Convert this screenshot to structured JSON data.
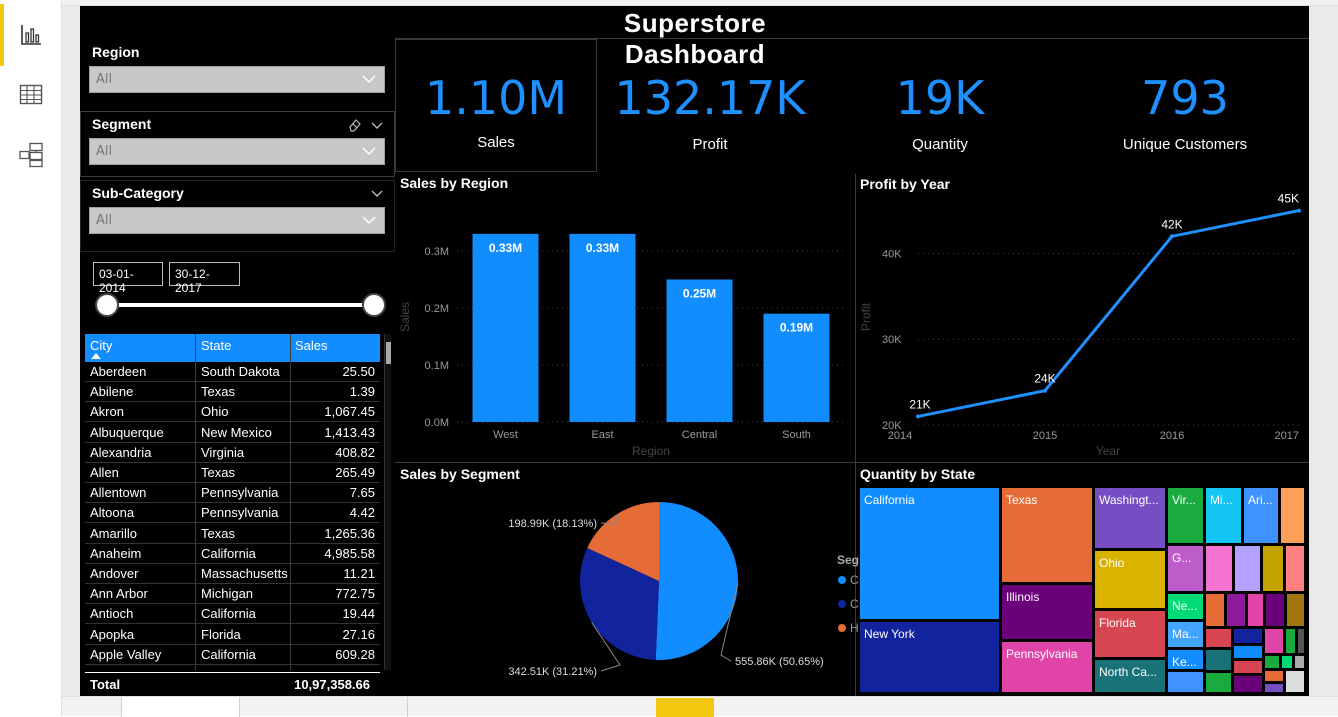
{
  "dashboard": {
    "title": "Superstore Dashboard"
  },
  "nav": {
    "items": [
      "report-view",
      "data-view",
      "model-view"
    ]
  },
  "slicers": {
    "region": {
      "label": "Region",
      "value": "All"
    },
    "segment": {
      "label": "Segment",
      "value": "All"
    },
    "subcategory": {
      "label": "Sub-Category",
      "value": "All"
    },
    "date": {
      "start": "03-01-2014",
      "end": "30-12-2017"
    }
  },
  "table": {
    "headers": [
      "City",
      "State",
      "Sales"
    ],
    "rows": [
      [
        "Aberdeen",
        "South Dakota",
        "25.50"
      ],
      [
        "Abilene",
        "Texas",
        "1.39"
      ],
      [
        "Akron",
        "Ohio",
        "1,067.45"
      ],
      [
        "Albuquerque",
        "New Mexico",
        "1,413.43"
      ],
      [
        "Alexandria",
        "Virginia",
        "408.82"
      ],
      [
        "Allen",
        "Texas",
        "265.49"
      ],
      [
        "Allentown",
        "Pennsylvania",
        "7.65"
      ],
      [
        "Altoona",
        "Pennsylvania",
        "4.42"
      ],
      [
        "Amarillo",
        "Texas",
        "1,265.36"
      ],
      [
        "Anaheim",
        "California",
        "4,985.58"
      ],
      [
        "Andover",
        "Massachusetts",
        "11.21"
      ],
      [
        "Ann Arbor",
        "Michigan",
        "772.75"
      ],
      [
        "Antioch",
        "California",
        "19.44"
      ],
      [
        "Apopka",
        "Florida",
        "27.16"
      ],
      [
        "Apple Valley",
        "California",
        "609.28"
      ]
    ],
    "total_label": "Total",
    "total_value": "10,97,358.66"
  },
  "kpis": [
    {
      "value": "1.10M",
      "label": "Sales"
    },
    {
      "value": "132.17K",
      "label": "Profit"
    },
    {
      "value": "19K",
      "label": "Quantity"
    },
    {
      "value": "793",
      "label": "Unique Customers"
    }
  ],
  "colors": {
    "accent": "#118dff",
    "line": "#1e90ff",
    "consumer": "#118dff",
    "corporate": "#12239e",
    "home_office": "#e66c37"
  },
  "chart_data": [
    {
      "type": "bar",
      "title": "Sales by Region",
      "xlabel": "Region",
      "ylabel": "Sales",
      "categories": [
        "West",
        "East",
        "Central",
        "South"
      ],
      "values": [
        0.33,
        0.33,
        0.25,
        0.19
      ],
      "data_labels": [
        "0.33M",
        "0.33M",
        "0.25M",
        "0.19M"
      ],
      "yticks": [
        "0.0M",
        "0.1M",
        "0.2M",
        "0.3M"
      ],
      "ylim": [
        0,
        0.33
      ],
      "grid": true
    },
    {
      "type": "line",
      "title": "Profit by Year",
      "xlabel": "Year",
      "ylabel": "Profit",
      "x": [
        "2014",
        "2015",
        "2016",
        "2017"
      ],
      "values": [
        21,
        24,
        42,
        45
      ],
      "data_labels": [
        "21K",
        "24K",
        "42K",
        "45K"
      ],
      "yticks": [
        "20K",
        "30K",
        "40K"
      ],
      "ylim": [
        20,
        46
      ],
      "grid": true
    },
    {
      "type": "pie",
      "title": "Sales by Segment",
      "legend_title": "Segment",
      "legend_position": "right",
      "slices": [
        {
          "name": "Consumer",
          "value": 555.86,
          "label": "555.86K (50.65%)"
        },
        {
          "name": "Corporate",
          "value": 342.51,
          "label": "342.51K (31.21%)"
        },
        {
          "name": "Home Office",
          "value": 198.99,
          "label": "198.99K (18.13%)"
        }
      ]
    },
    {
      "type": "treemap",
      "title": "Quantity by State",
      "labels": [
        "California",
        "New York",
        "Texas",
        "Illinois",
        "Pennsylvania",
        "Washingt...",
        "Ohio",
        "Florida",
        "North Ca...",
        "Vir...",
        "Mi...",
        "Ari...",
        "G...",
        "Ne...",
        "Ma...",
        "Ke..."
      ]
    }
  ]
}
